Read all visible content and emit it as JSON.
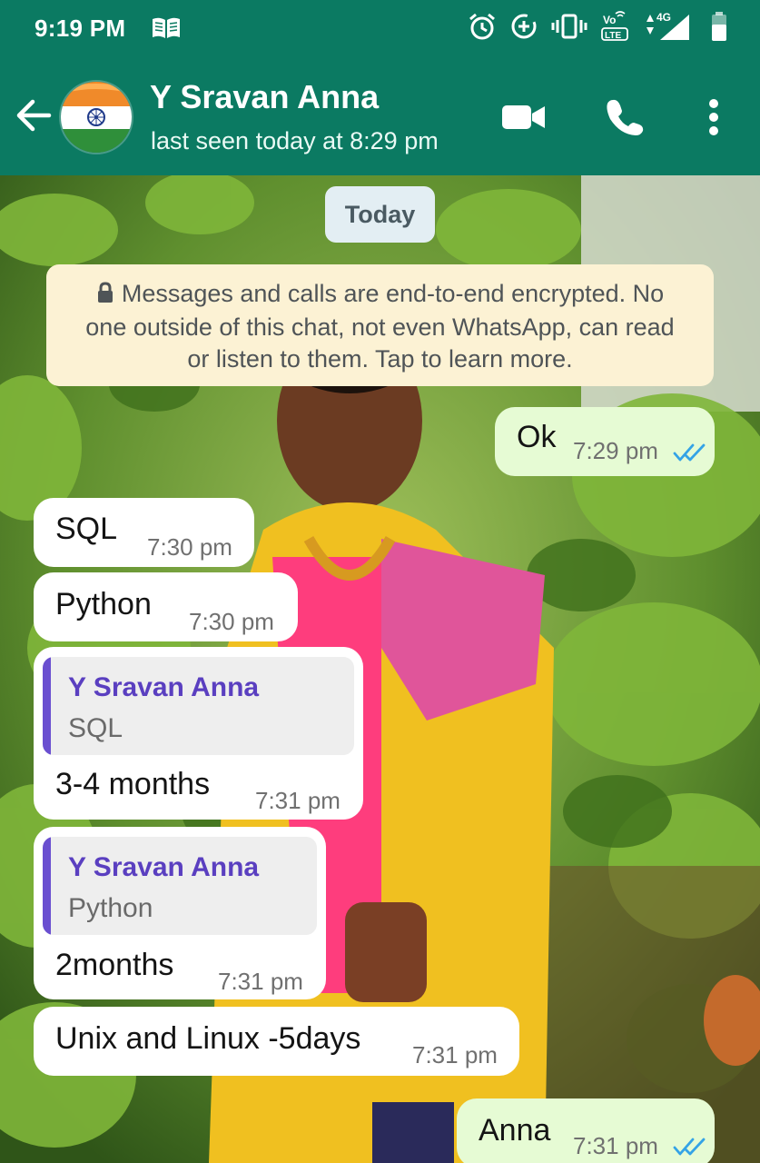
{
  "status_bar": {
    "time": "9:19 PM",
    "book_icon": "book-icon",
    "network": "4G",
    "volte": "Vo LTE",
    "icons": [
      "alarm-icon",
      "data-saver-icon",
      "vibrate-icon",
      "volte-icon",
      "signal-icon",
      "battery-icon"
    ]
  },
  "header": {
    "contact_name": "Y Sravan Anna",
    "last_seen": "last seen today at 8:29 pm",
    "avatar": "india-flag-avatar",
    "actions": [
      "video-call-icon",
      "voice-call-icon",
      "more-options-icon"
    ],
    "colors": {
      "bar": "#0b7a62"
    }
  },
  "chat": {
    "date_chip": "Today",
    "encryption_notice": "Messages and calls are end-to-end encrypted. No one outside of this chat, not even WhatsApp, can read or listen to them. Tap to learn more.",
    "messages": [
      {
        "dir": "out",
        "text": "Ok",
        "time": "7:29 pm",
        "status": "read"
      },
      {
        "dir": "in",
        "text": "SQL",
        "time": "7:30 pm"
      },
      {
        "dir": "in",
        "text": "Python",
        "time": "7:30 pm"
      },
      {
        "dir": "in",
        "quote_name": "Y Sravan Anna",
        "quote_text": "SQL",
        "text": "3-4 months",
        "time": "7:31 pm"
      },
      {
        "dir": "in",
        "quote_name": "Y Sravan Anna",
        "quote_text": "Python",
        "text": "2months",
        "time": "7:31 pm"
      },
      {
        "dir": "in",
        "text": "Unix and Linux -5days",
        "time": "7:31 pm"
      },
      {
        "dir": "out",
        "text": "Anna",
        "time": "7:31 pm",
        "status": "read"
      }
    ],
    "colors": {
      "outgoing": "#e6fbd4",
      "incoming": "#ffffff",
      "read_ticks": "#34a3e6",
      "quote_bar": "#6a4fd0"
    }
  }
}
